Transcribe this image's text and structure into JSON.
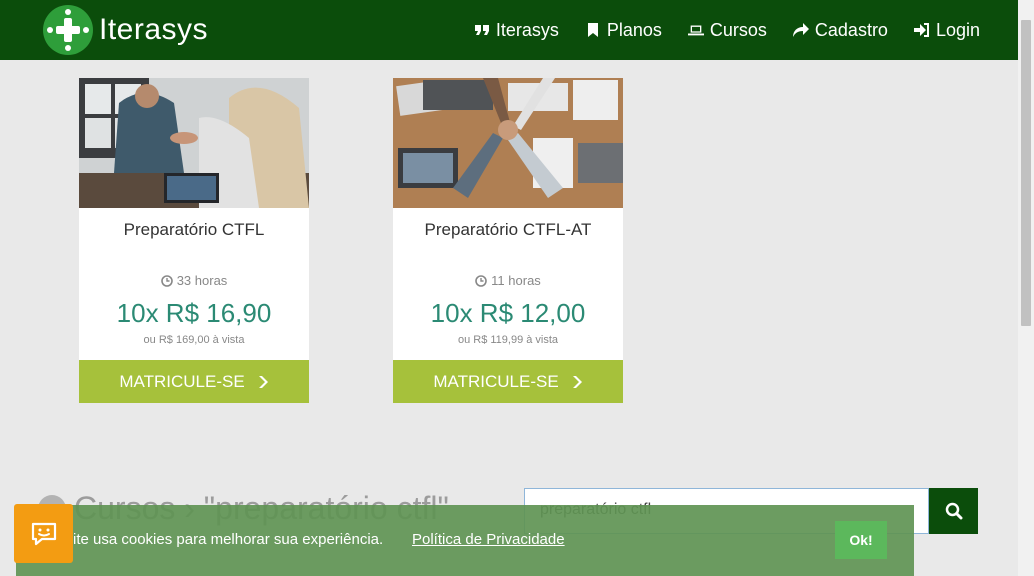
{
  "brand": {
    "name": "Iterasys"
  },
  "nav": [
    {
      "label": "Iterasys",
      "icon": "quote-icon"
    },
    {
      "label": "Planos",
      "icon": "bookmark-icon"
    },
    {
      "label": "Cursos",
      "icon": "laptop-icon"
    },
    {
      "label": "Cadastro",
      "icon": "share-icon"
    },
    {
      "label": "Login",
      "icon": "sign-in-icon"
    }
  ],
  "courses": [
    {
      "title": "Preparatório CTFL",
      "hours": "33 horas",
      "price": "10x R$ 16,90",
      "cash": "ou R$ 169,00 à vista",
      "button": "MATRICULE-SE"
    },
    {
      "title": "Preparatório CTFL-AT",
      "hours": "11 horas",
      "price": "10x R$ 12,00",
      "cash": "ou R$ 119,99 à vista",
      "button": "MATRICULE-SE"
    }
  ],
  "breadcrumb": "Cursos › \"preparatório ctfl\"",
  "search": {
    "value": "preparatório ctfl"
  },
  "cookie": {
    "text": "ite usa cookies para melhorar sua experiência.",
    "link": "Política de Privacidade",
    "ok": "Ok!"
  },
  "colors": {
    "navbar": "#0b4d0b",
    "accent": "#a6c13b",
    "price": "#2b8a74",
    "chat": "#f39c12"
  }
}
